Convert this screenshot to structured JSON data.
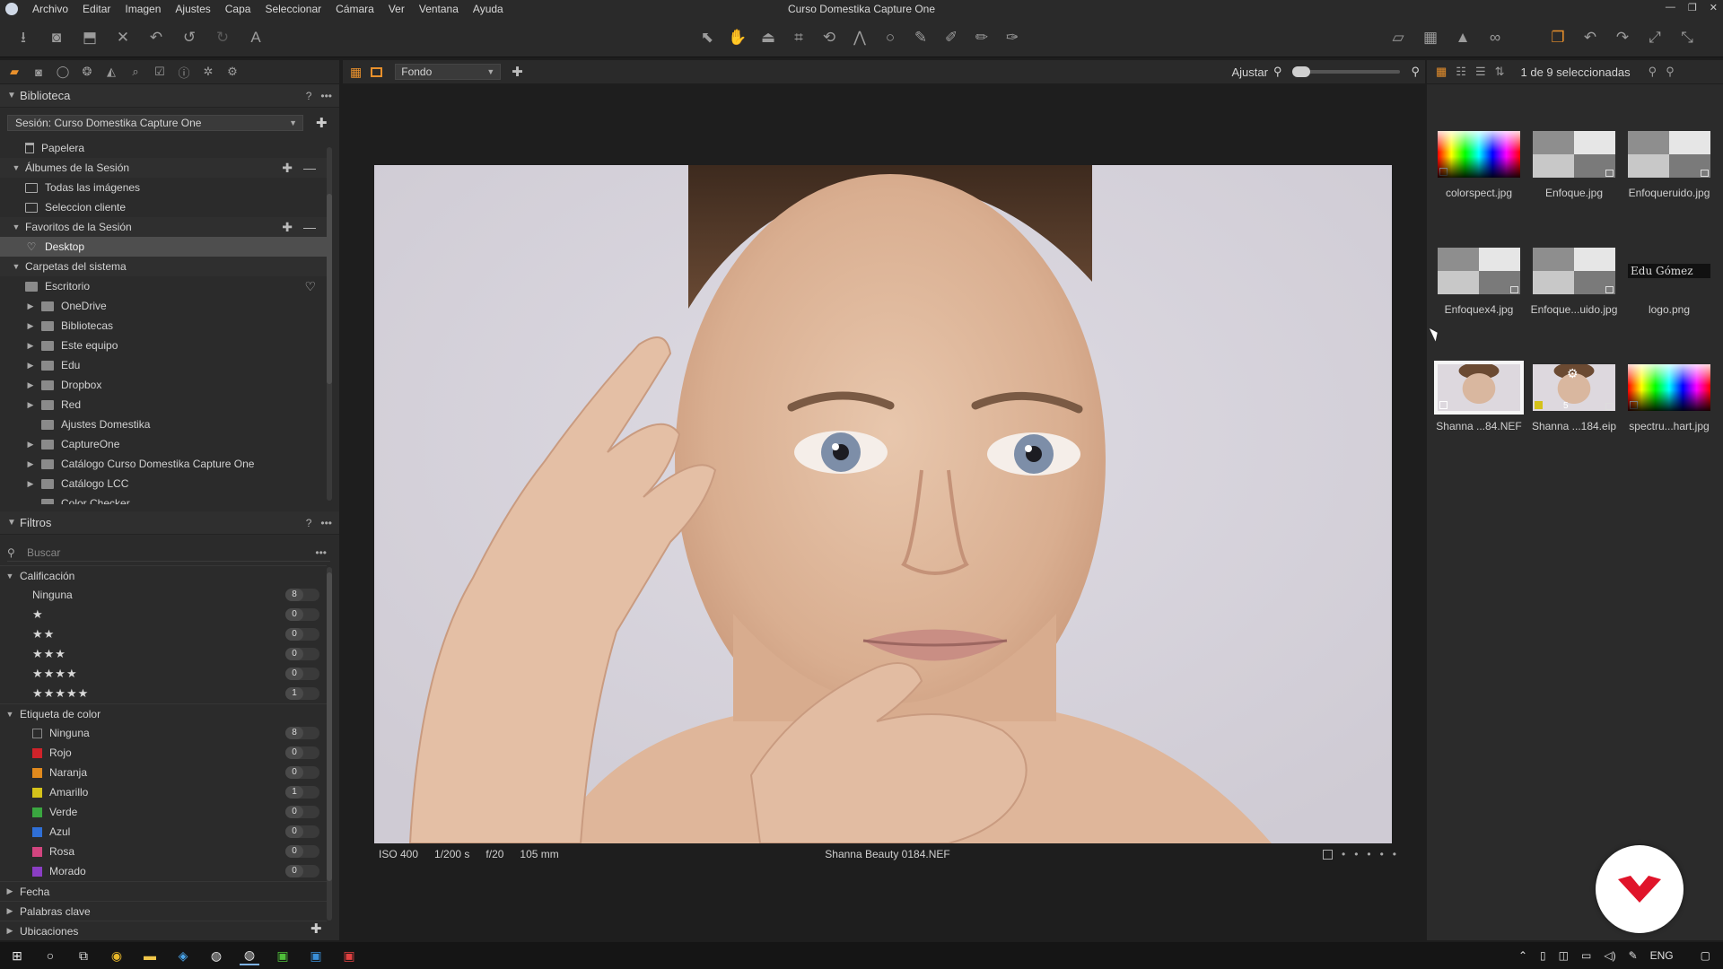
{
  "window": {
    "title": "Curso Domestika Capture One",
    "menu": [
      "Archivo",
      "Editar",
      "Imagen",
      "Ajustes",
      "Capa",
      "Seleccionar",
      "Cámara",
      "Ver",
      "Ventana",
      "Ayuda"
    ]
  },
  "toolbar": {
    "left_icons": [
      "import-icon",
      "camera-icon",
      "export-icon",
      "delete-icon",
      "undo-history-icon",
      "undo-icon",
      "redo-icon",
      "text-icon"
    ],
    "center_icons": [
      "select-cursor-icon",
      "pan-hand-icon",
      "straighten-icon",
      "crop-icon",
      "rotate-icon",
      "keystone-icon",
      "spot-icon",
      "brush-icon",
      "eraser-icon",
      "gradient-icon",
      "clone-icon"
    ],
    "right_icons": [
      "proof-icon",
      "grid-overlay-icon",
      "exposure-warning-icon",
      "glasses-icon",
      "layers-icon",
      "rotate-left-icon",
      "rotate-right-icon",
      "expand-icon",
      "collapse-icon"
    ]
  },
  "library": {
    "title": "Biblioteca",
    "session": "Sesión: Curso Domestika Capture One",
    "rows": [
      {
        "label": "Papelera",
        "type": "item",
        "icon": "trash"
      },
      {
        "label": "Álbumes de la Sesión",
        "type": "section"
      },
      {
        "label": "Todas las imágenes",
        "type": "item",
        "icon": "album"
      },
      {
        "label": "Seleccion cliente",
        "type": "item",
        "icon": "album"
      },
      {
        "label": "Favoritos de la Sesión",
        "type": "section"
      },
      {
        "label": "Desktop",
        "type": "item",
        "icon": "heart",
        "selected": true
      },
      {
        "label": "Carpetas del sistema",
        "type": "section"
      },
      {
        "label": "Escritorio",
        "type": "item",
        "icon": "folder"
      },
      {
        "label": "OneDrive",
        "type": "folder",
        "icon": "folder"
      },
      {
        "label": "Bibliotecas",
        "type": "folder",
        "icon": "folder"
      },
      {
        "label": "Este equipo",
        "type": "folder",
        "icon": "folder"
      },
      {
        "label": "Edu",
        "type": "folder",
        "icon": "folder"
      },
      {
        "label": "Dropbox",
        "type": "folder",
        "icon": "folder"
      },
      {
        "label": "Red",
        "type": "folder",
        "icon": "folder"
      },
      {
        "label": "Ajustes Domestika",
        "type": "plain",
        "icon": "folder"
      },
      {
        "label": "CaptureOne",
        "type": "folder",
        "icon": "folder"
      },
      {
        "label": "Catálogo Curso Domestika Capture One",
        "type": "folder",
        "icon": "folder"
      },
      {
        "label": "Catálogo LCC",
        "type": "folder",
        "icon": "folder"
      },
      {
        "label": "Color Checker",
        "type": "plain",
        "icon": "folder"
      }
    ]
  },
  "filters": {
    "title": "Filtros",
    "search_placeholder": "Buscar",
    "rating_title": "Calificación",
    "ratings": [
      {
        "label": "Ninguna",
        "count": "8"
      },
      {
        "label": "★",
        "count": "0"
      },
      {
        "label": "★★",
        "count": "0"
      },
      {
        "label": "★★★",
        "count": "0"
      },
      {
        "label": "★★★★",
        "count": "0"
      },
      {
        "label": "★★★★★",
        "count": "1"
      }
    ],
    "color_title": "Etiqueta de color",
    "colors": [
      {
        "label": "Ninguna",
        "count": "8",
        "color": "none"
      },
      {
        "label": "Rojo",
        "count": "0",
        "color": "#d0232a"
      },
      {
        "label": "Naranja",
        "count": "0",
        "color": "#e08a1e"
      },
      {
        "label": "Amarillo",
        "count": "1",
        "color": "#d4c21a"
      },
      {
        "label": "Verde",
        "count": "0",
        "color": "#3aa640"
      },
      {
        "label": "Azul",
        "count": "0",
        "color": "#2f6fd6"
      },
      {
        "label": "Rosa",
        "count": "0",
        "color": "#d2457f"
      },
      {
        "label": "Morado",
        "count": "0",
        "color": "#8a3ec4"
      }
    ],
    "collapsed": [
      "Fecha",
      "Palabras clave",
      "Ubicaciones"
    ]
  },
  "viewer": {
    "layer_select": "Fondo",
    "zoom_label": "Ajustar",
    "image": {
      "iso": "ISO 400",
      "shutter": "1/200 s",
      "aperture": "f/20",
      "focal": "105 mm",
      "filename": "Shanna Beauty 0184.NEF"
    }
  },
  "browser": {
    "selection": "1 de 9 seleccionadas",
    "thumbs": [
      {
        "name": "colorspect.jpg",
        "kind": "spectrum"
      },
      {
        "name": "Enfoque.jpg",
        "kind": "gray"
      },
      {
        "name": "Enfoqueruido.jpg",
        "kind": "gray"
      },
      {
        "name": "Enfoquex4.jpg",
        "kind": "gray"
      },
      {
        "name": "Enfoque...uido.jpg",
        "kind": "gray"
      },
      {
        "name": "logo.png",
        "kind": "logo",
        "logo_text": "Edu Gómez"
      },
      {
        "name": "Shanna ...84.NEF",
        "kind": "face",
        "selected": true
      },
      {
        "name": "Shanna ...184.eip",
        "kind": "face-fx",
        "label_num": "5"
      },
      {
        "name": "spectru...hart.jpg",
        "kind": "spectrum"
      }
    ]
  },
  "taskbar": {
    "lang": "ENG"
  },
  "colors": {
    "accent": "#e8902c",
    "brand_watermark": "#e0142a"
  }
}
